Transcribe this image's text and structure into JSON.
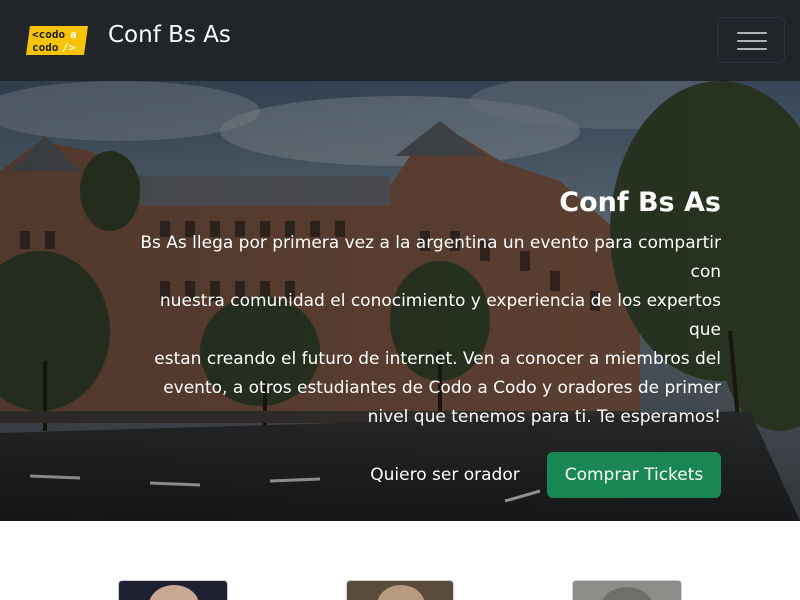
{
  "navbar": {
    "logo_text_line1": "codo",
    "logo_text_line2": "codo",
    "logo_text_a": "a",
    "brand_title": "Conf Bs As",
    "colors": {
      "background": "#212529",
      "logo_yellow": "#f8c300"
    }
  },
  "hero": {
    "title": "Conf Bs As",
    "description_lines": [
      "Bs As llega por primera vez a la argentina un evento para compartir",
      "con",
      "nuestra comunidad el conocimiento y experiencia de los expertos",
      "que",
      "estan creando el futuro de internet. Ven a conocer a miembros del",
      "evento, a otros estudiantes de Codo a Codo y oradores de primer",
      "nivel que tenemos para ti. Te esperamos!"
    ],
    "secondary_button": "Quiero ser orador",
    "primary_button": "Comprar Tickets",
    "colors": {
      "primary_button": "#198754"
    }
  },
  "speakers": {
    "cards": [
      {
        "name": "speaker-card-1"
      },
      {
        "name": "speaker-card-2"
      },
      {
        "name": "speaker-card-3"
      }
    ]
  },
  "icons": {
    "toggler": "hamburger-menu-icon"
  }
}
